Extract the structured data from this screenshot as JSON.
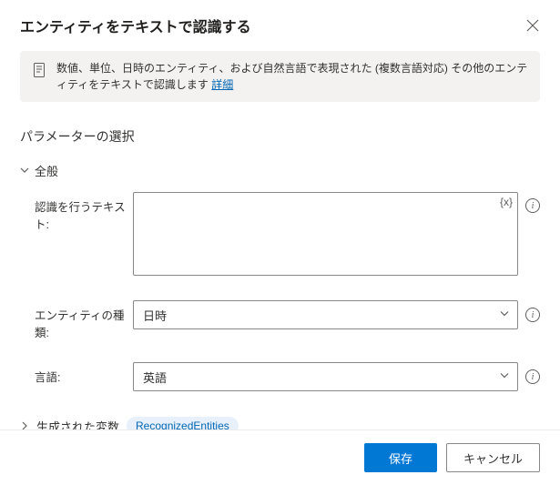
{
  "header": {
    "title": "エンティティをテキストで認識する"
  },
  "info": {
    "text": "数値、単位、日時のエンティティ、および自然言語で表現された (複数言語対応) その他のエンティティをテキストで認識します ",
    "link": "詳細"
  },
  "section": {
    "params_title": "パラメーターの選択",
    "general": "全般"
  },
  "fields": {
    "text_label": "認識を行うテキスト:",
    "text_value": "",
    "var_token": "{x}",
    "entity_type_label": "エンティティの種類:",
    "entity_type_value": "日時",
    "language_label": "言語:",
    "language_value": "英語"
  },
  "generated": {
    "label": "生成された変数",
    "chip": "RecognizedEntities"
  },
  "footer": {
    "save": "保存",
    "cancel": "キャンセル"
  }
}
